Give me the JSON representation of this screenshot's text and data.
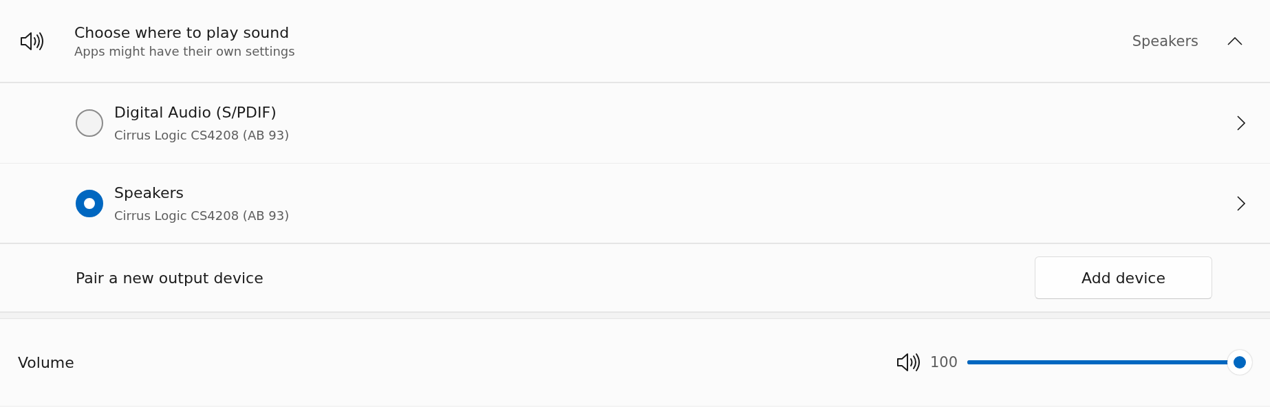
{
  "output": {
    "title": "Choose where to play sound",
    "subtitle": "Apps might have their own settings",
    "current": "Speakers",
    "expanded": true
  },
  "devices": [
    {
      "name": "Digital Audio (S/PDIF)",
      "detail": "Cirrus Logic CS4208 (AB 93)",
      "selected": false
    },
    {
      "name": "Speakers",
      "detail": "Cirrus Logic CS4208 (AB 93)",
      "selected": true
    }
  ],
  "pair": {
    "label": "Pair a new output device",
    "button": "Add device"
  },
  "volume": {
    "label": "Volume",
    "reading": "100",
    "level": 1.0
  }
}
